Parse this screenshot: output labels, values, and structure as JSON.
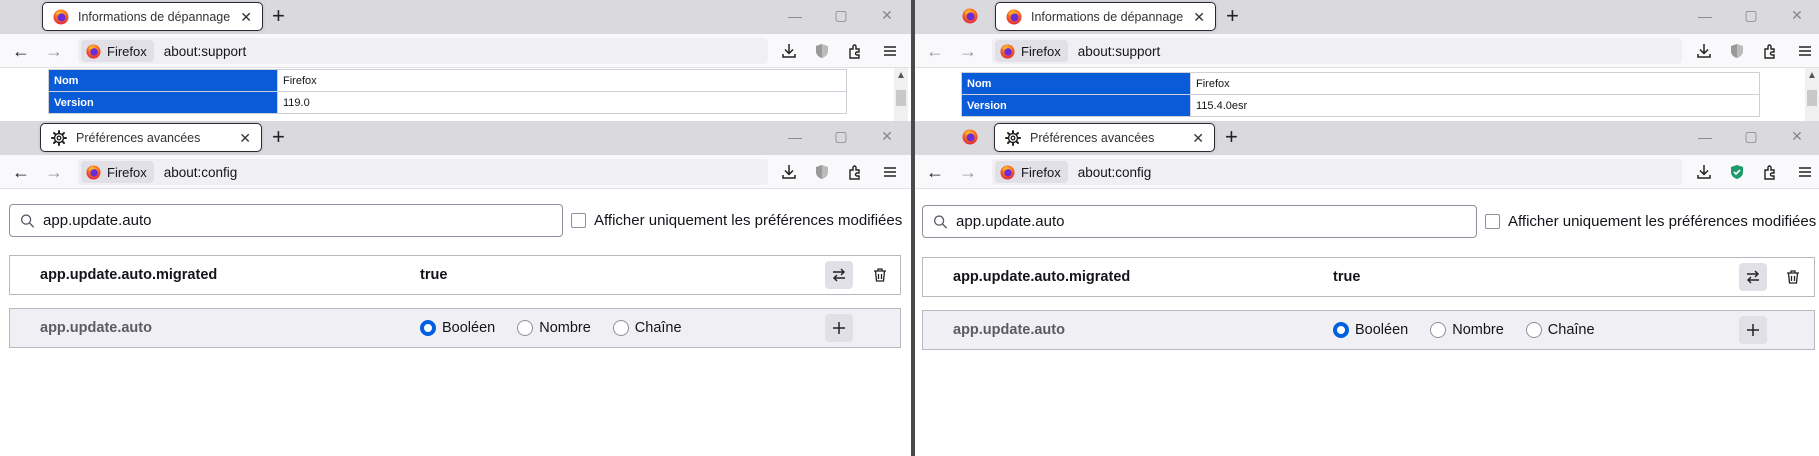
{
  "windows": {
    "left": {
      "support": {
        "tab_title": "Informations de dépannage",
        "identity_label": "Firefox",
        "url": "about:support",
        "table": [
          {
            "key": "Nom",
            "value": "Firefox"
          },
          {
            "key": "Version",
            "value": "119.0"
          }
        ]
      },
      "config": {
        "tab_title": "Préférences avancées",
        "identity_label": "Firefox",
        "url": "about:config",
        "search_value": "app.update.auto",
        "checkbox_label": "Afficher uniquement les préférences modifiées",
        "pref_name": "app.update.auto.migrated",
        "pref_value": "true",
        "new_pref_name": "app.update.auto",
        "types": [
          "Booléen",
          "Nombre",
          "Chaîne"
        ]
      }
    },
    "right": {
      "support": {
        "tab_title": "Informations de dépannage",
        "identity_label": "Firefox",
        "url": "about:support",
        "table": [
          {
            "key": "Nom",
            "value": "Firefox"
          },
          {
            "key": "Version",
            "value": "115.4.0esr"
          }
        ]
      },
      "config": {
        "tab_title": "Préférences avancées",
        "identity_label": "Firefox",
        "url": "about:config",
        "search_value": "app.update.auto",
        "checkbox_label": "Afficher uniquement les préférences modifiées",
        "pref_name": "app.update.auto.migrated",
        "pref_value": "true",
        "new_pref_name": "app.update.auto",
        "types": [
          "Booléen",
          "Nombre",
          "Chaîne"
        ]
      }
    }
  },
  "colors": {
    "accent": "#0061e0",
    "table_key_bg": "#0a5bd8",
    "shield_green": "#1f9b6b"
  }
}
